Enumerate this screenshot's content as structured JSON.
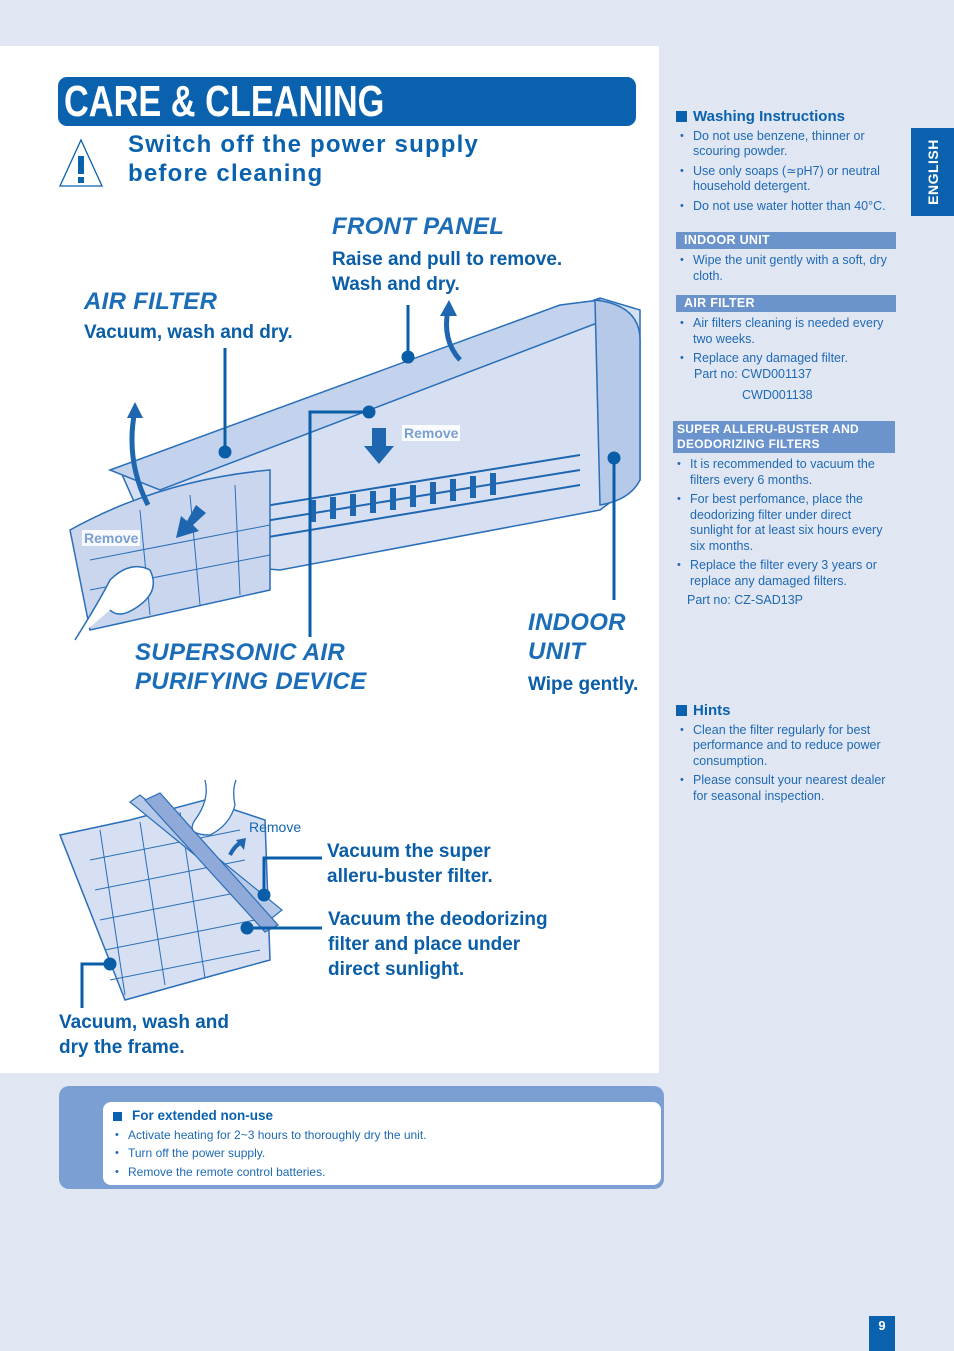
{
  "page": {
    "title": "CARE & CLEANING",
    "warning": [
      "Switch off the power supply",
      "before cleaning"
    ],
    "language_tab": "ENGLISH",
    "page_number": "9"
  },
  "diagram_top": {
    "front_panel": {
      "heading": "FRONT PANEL",
      "lines": [
        "Raise and pull to remove.",
        "Wash and dry."
      ]
    },
    "air_filter": {
      "heading": "AIR FILTER",
      "line": "Vacuum, wash and dry."
    },
    "supersonic": {
      "heading_lines": [
        "SUPERSONIC AIR",
        "PURIFYING DEVICE"
      ]
    },
    "indoor_unit": {
      "heading_lines": [
        "INDOOR",
        "UNIT"
      ],
      "line": "Wipe gently."
    },
    "remove_labels": [
      "Remove",
      "Remove"
    ]
  },
  "diagram_bottom": {
    "remove_label": "Remove",
    "super_alleru": [
      "Vacuum the super",
      "alleru-buster filter."
    ],
    "deodorizing": [
      "Vacuum the deodorizing",
      "filter and place under",
      "direct sunlight."
    ],
    "frame": [
      "Vacuum, wash and",
      "dry the frame."
    ]
  },
  "right_column": {
    "washing": {
      "heading": "Washing Instructions",
      "items": [
        "Do not use benzene, thinner or scouring powder.",
        "Use only soaps (≃pH7) or neutral household detergent.",
        "Do not use water hotter than 40°C."
      ]
    },
    "indoor_unit": {
      "band": "INDOOR UNIT",
      "items": [
        "Wipe the unit gently with a soft, dry cloth."
      ]
    },
    "air_filter": {
      "band": "AIR FILTER",
      "items": [
        "Air filters cleaning is needed every two weeks.",
        "Replace any damaged filter."
      ],
      "part_label": "Part no: CWD001137",
      "part_extra": "CWD001138"
    },
    "super_alleru": {
      "band_lines": [
        "SUPER ALLERU-BUSTER AND",
        "DEODORIZING FILTERS"
      ],
      "items": [
        "It is recommended to vacuum the filters every 6 months.",
        "For best perfomance, place the deodorizing filter under direct sunlight for at least six hours every six months.",
        "Replace the filter every 3 years or replace any damaged filters."
      ],
      "part_label": "Part no: CZ-SAD13P"
    },
    "hints": {
      "heading": "Hints",
      "items": [
        "Clean the filter regularly for best performance and to reduce power consumption.",
        "Please consult your nearest dealer for seasonal inspection."
      ]
    }
  },
  "non_use": {
    "heading": "For extended non-use",
    "items": [
      "Activate heating for 2~3 hours to thoroughly dry the unit.",
      "Turn off the power supply.",
      "Remove the remote control batteries."
    ]
  },
  "colors": {
    "brand_blue": "#0a62ae",
    "band_blue": "#6b93cc",
    "page_bg": "#e1e6f3",
    "illustration_fill": "#c9d6ee"
  }
}
